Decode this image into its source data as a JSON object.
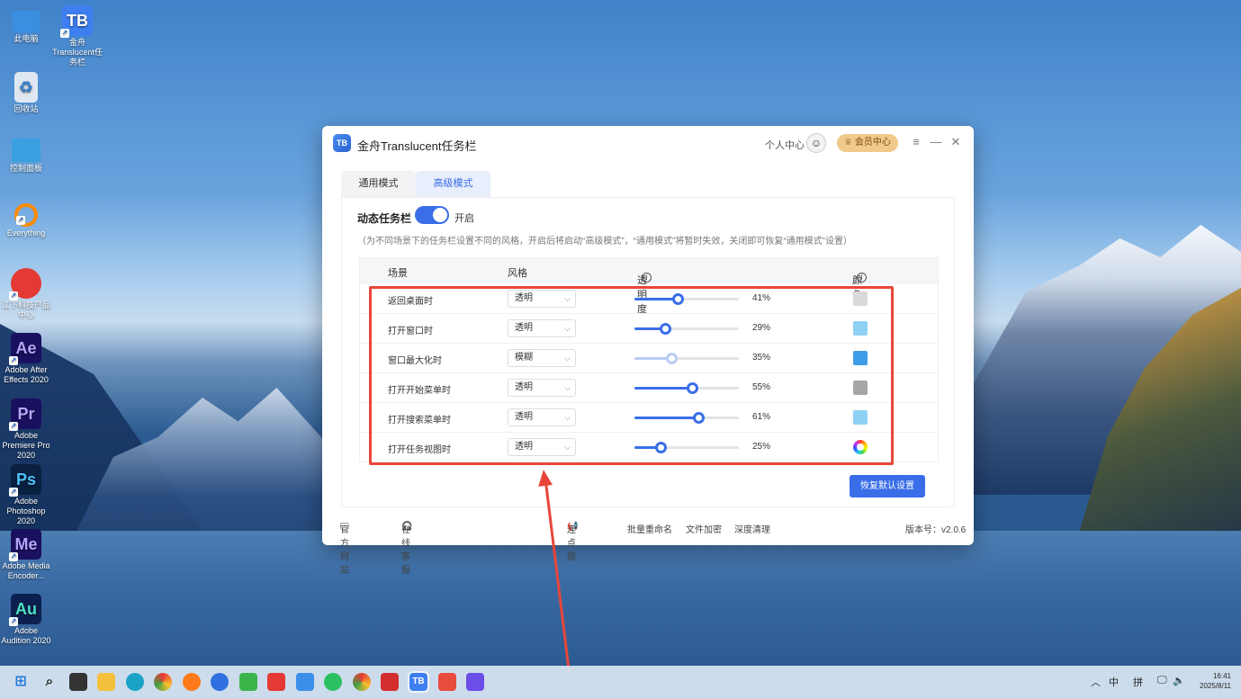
{
  "desktop": {
    "icons": [
      {
        "label": "此电脑",
        "glyph": "",
        "color": "#3a8fe0"
      },
      {
        "label": "金舟Translucent任务栏",
        "glyph": "TB",
        "color": "#3d7ff0"
      },
      {
        "label": "回收站",
        "glyph": "♻",
        "color": "#dfe8f2"
      },
      {
        "label": "控制面板",
        "glyph": "",
        "color": "#3aa0e0"
      },
      {
        "label": "Everything",
        "glyph": "",
        "color": "#ff8a00"
      },
      {
        "label": "江下科技产品中心",
        "glyph": "",
        "color": "#e53935"
      },
      {
        "label": "Adobe After Effects 2020",
        "glyph": "Ae",
        "color": "#1a1060"
      },
      {
        "label": "Adobe Premiere Pro 2020",
        "glyph": "Pr",
        "color": "#1a1060"
      },
      {
        "label": "Adobe Photoshop 2020",
        "glyph": "Ps",
        "color": "#0a2040"
      },
      {
        "label": "Adobe Media Encoder...",
        "glyph": "Me",
        "color": "#1a1060"
      },
      {
        "label": "Adobe Audition 2020",
        "glyph": "Au",
        "color": "#0c2050"
      }
    ]
  },
  "window": {
    "logo": "TB",
    "title": "金舟Translucent任务栏",
    "profile_label": "个人中心",
    "vip_label": "会员中心",
    "menu_icon": "≡",
    "minimize_icon": "—",
    "close_icon": "✕"
  },
  "tabs": [
    {
      "label": "通用模式",
      "active": false
    },
    {
      "label": "高级模式",
      "active": true
    }
  ],
  "dynamic": {
    "label": "动态任务栏",
    "toggle_state": "开启",
    "note": "（为不同场景下的任务栏设置不同的风格，开启后将启动“高级模式”，“通用模式”将暂时失效，关闭即可恢复“通用模式”设置）"
  },
  "table": {
    "headers": {
      "scene": "场景",
      "style": "风格",
      "opacity": "透明度",
      "color": "颜色"
    },
    "rows": [
      {
        "scene": "返回桌面时",
        "style": "透明",
        "opacity": 41,
        "opacity_label": "41%",
        "color": "#d9d9d9",
        "disabled": false
      },
      {
        "scene": "打开窗口时",
        "style": "透明",
        "opacity": 29,
        "opacity_label": "29%",
        "color": "#8fd0f5",
        "disabled": false
      },
      {
        "scene": "窗口最大化时",
        "style": "模糊",
        "opacity": 35,
        "opacity_label": "35%",
        "color": "#3f9de8",
        "disabled": true
      },
      {
        "scene": "打开开始菜单时",
        "style": "透明",
        "opacity": 55,
        "opacity_label": "55%",
        "color": "#a6a6a6",
        "disabled": false
      },
      {
        "scene": "打开搜索菜单时",
        "style": "透明",
        "opacity": 61,
        "opacity_label": "61%",
        "color": "#8fd0f5",
        "disabled": false
      },
      {
        "scene": "打开任务视图时",
        "style": "透明",
        "opacity": 25,
        "opacity_label": "25%",
        "color": "rainbow",
        "disabled": false
      }
    ]
  },
  "restore_label": "恢复默认设置",
  "footer": {
    "website": "官方网站",
    "support": "在线客服",
    "clicker": "连点器",
    "rename": "批量重命名",
    "encrypt": "文件加密",
    "clean": "深度清理",
    "version": "版本号：v2.0.6"
  },
  "taskbar": {
    "ime_lang": "中",
    "ime_mode": "拼",
    "time": "16:41",
    "date": "2025/8/11"
  },
  "colors": {
    "accent": "#3a6ee8",
    "highlight": "#e8463a",
    "vip": "#f1c98a"
  }
}
